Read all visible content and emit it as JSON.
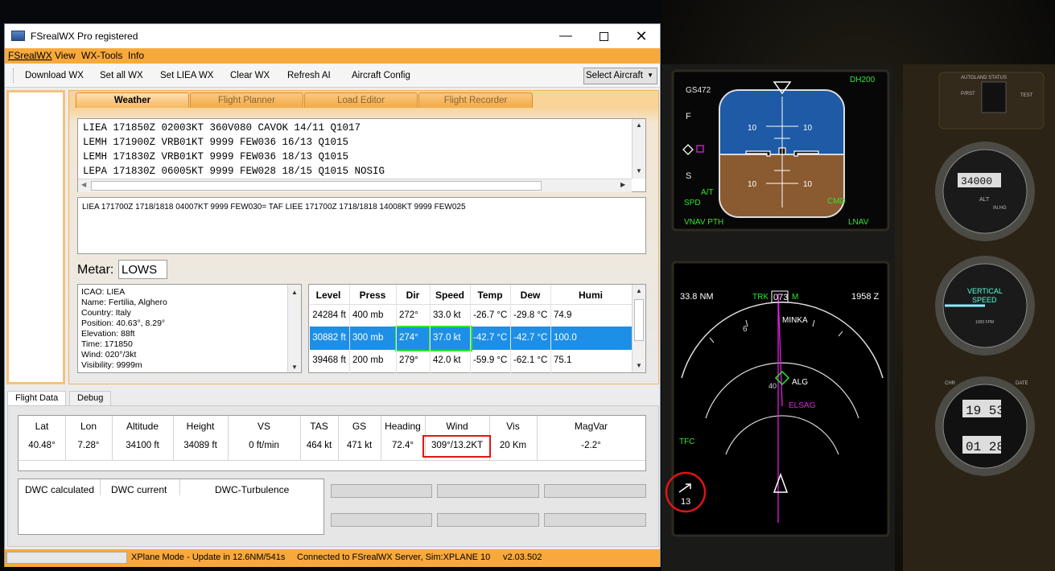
{
  "window": {
    "title": "FSrealWX Pro registered"
  },
  "menu": [
    "FSrealWX",
    "View",
    "WX-Tools",
    "Info"
  ],
  "toolbar": {
    "buttons": [
      "Download WX",
      "Set all WX",
      "Set LIEA WX",
      "Clear WX",
      "Refresh AI",
      "Aircraft Config"
    ],
    "select_aircraft": "Select Aircraft"
  },
  "tabs": [
    "Weather",
    "Flight Planner",
    "Load Editor",
    "Flight Recorder"
  ],
  "metar_lines": [
    "LIEA 171850Z 02003KT 360V080 CAVOK 14/11 Q1017",
    "LEMH 171900Z VRB01KT 9999 FEW036 16/13 Q1015",
    "LEMH 171830Z VRB01KT 9999 FEW036 18/13 Q1015",
    "LEPA 171830Z 06005KT 9999 FEW028 18/15 Q1015 NOSIG"
  ],
  "taf": "LIEA 171700Z 1718/1818 04007KT 9999 FEW030= TAF LIEE 171700Z 1718/1818 14008KT 9999 FEW025",
  "metar_label": "Metar:",
  "metar_input": "LOWS",
  "station_info": [
    "ICAO: LIEA",
    "Name: Fertilia, Alghero",
    "Country: Italy",
    "Position: 40.63°, 8.29°",
    "Elevation: 88ft",
    "Time: 171850",
    "Wind: 020°/3kt",
    "Visibility: 9999m"
  ],
  "wind_table": {
    "headers": [
      "Level",
      "Press",
      "Dir",
      "Speed",
      "Temp",
      "Dew",
      "Humi"
    ],
    "rows": [
      [
        "24284 ft",
        "400 mb",
        "272°",
        "33.0 kt",
        "-26.7 °C",
        "-29.8 °C",
        "74.9"
      ],
      [
        "30882 ft",
        "300 mb",
        "274°",
        "37.0 kt",
        "-42.7 °C",
        "-42.7 °C",
        "100.0"
      ],
      [
        "39468 ft",
        "200 mb",
        "279°",
        "42.0 kt",
        "-59.9 °C",
        "-62.1 °C",
        "75.1"
      ]
    ],
    "selected_row": 1
  },
  "bottom_tabs": [
    "Flight Data",
    "Debug"
  ],
  "flight_data": {
    "headers": [
      "Lat",
      "Lon",
      "Altitude",
      "Height",
      "VS",
      "TAS",
      "GS",
      "Heading",
      "Wind",
      "Vis",
      "MagVar"
    ],
    "values": [
      "40.48°",
      "7.28°",
      "34100 ft",
      "34089 ft",
      "0 ft/min",
      "464 kt",
      "471 kt",
      "72.4°",
      "309°/13.2KT",
      "20 Km",
      "-2.2°"
    ]
  },
  "dwc": {
    "headers": [
      "DWC calculated",
      "DWC current",
      "DWC-Turbulence"
    ]
  },
  "statusbar": {
    "mode": "XPlane Mode - Update in 12.6NM/541s",
    "connection": "Connected to FSrealWX Server, Sim:XPLANE 10",
    "version": "v2.03.502"
  },
  "cockpit": {
    "adi": {
      "gs_label": "GS472",
      "dh_label": "DH200",
      "at_label": "A/T",
      "spd_label": "SPD",
      "cmd_label": "CMD",
      "vnav_label": "VNAV PTH",
      "lnav_label": "LNAV",
      "pitch_marks": [
        "10",
        "10",
        "10",
        "10"
      ],
      "side_letters": [
        "F",
        "S"
      ]
    },
    "nd": {
      "range": "33.8 NM",
      "trk_label": "TRK",
      "track": "073",
      "mag_label": "M",
      "zulu": "1958 Z",
      "waypoints": [
        "MINKA",
        "ALG",
        "ELSAG"
      ],
      "arc_labels": [
        "6",
        "40"
      ],
      "tfc_label": "TFC",
      "wind_speed": "13"
    },
    "gauges": {
      "autoland": "AUTOLAND STATUS",
      "pbst": "P/RST",
      "test": "TEST",
      "alt_readout": "34000",
      "alt_label": "ALT",
      "inhg_label": "IN.HG",
      "vs_title1": "VERTICAL",
      "vs_title2": "SPEED",
      "vs_unit": "1000 FPM",
      "clock_chr": "CHR",
      "clock_date": "DATE",
      "clock_time1": "19 53",
      "clock_time2": "01 28"
    }
  }
}
